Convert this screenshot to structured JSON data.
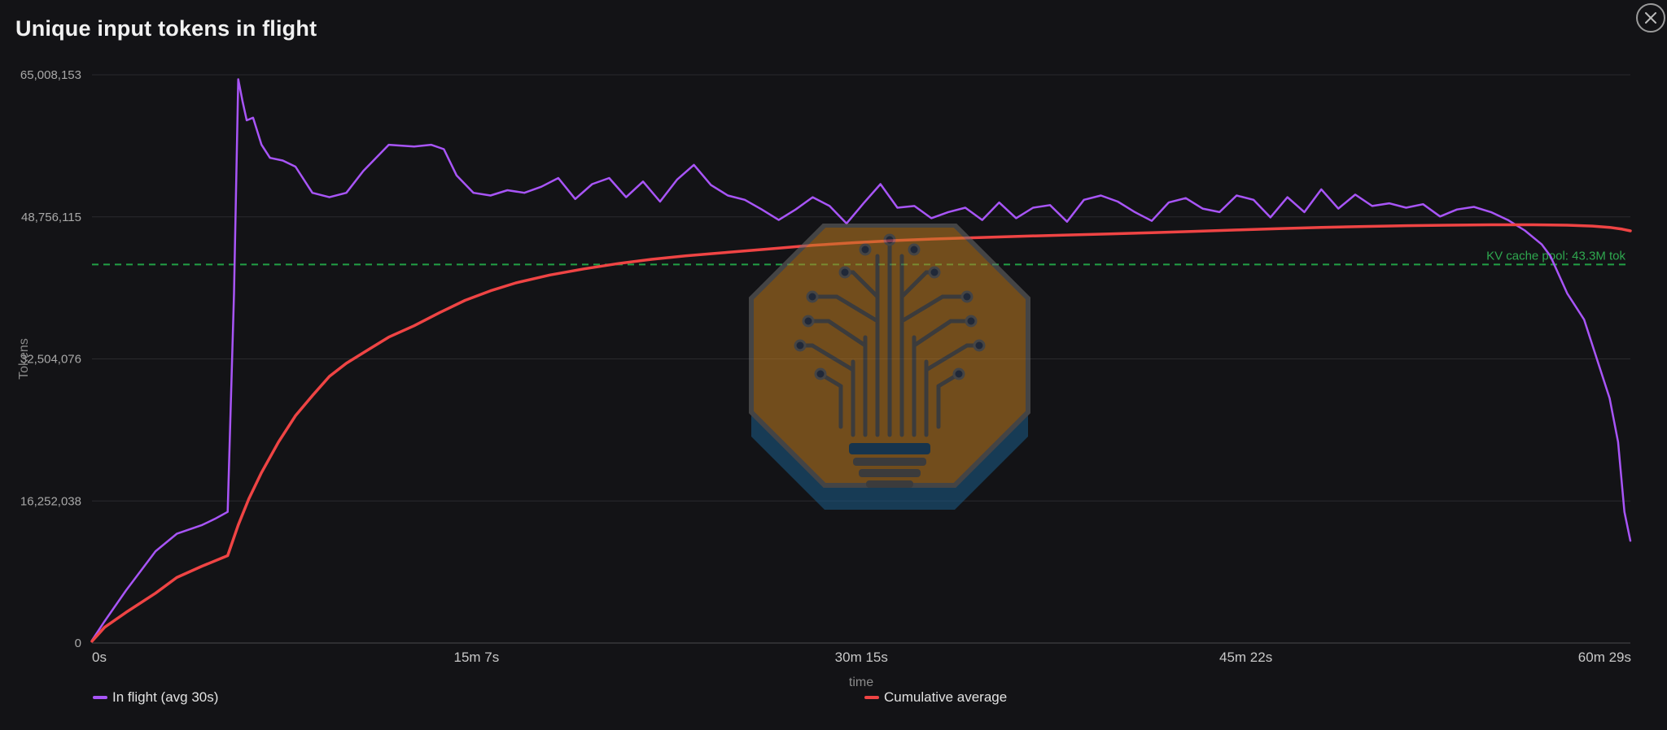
{
  "title": "Unique input tokens in flight",
  "close_icon": "close-icon",
  "colors": {
    "in_flight": "#a855f7",
    "cumulative": "#ef4444",
    "reference": "#22a045",
    "grid": "#2a2a2e",
    "background": "#131316"
  },
  "chart_data": {
    "type": "line",
    "title": "Unique input tokens in flight",
    "xlabel": "time",
    "ylabel": "Tokens",
    "x_unit": "seconds",
    "xlim": [
      0,
      3629
    ],
    "ylim": [
      0,
      65008153
    ],
    "x_tick_values": [
      0,
      907,
      1815,
      2722,
      3629
    ],
    "x_tick_labels": [
      "0s",
      "15m 7s",
      "30m 15s",
      "45m 22s",
      "60m 29s"
    ],
    "y_tick_values": [
      0,
      16252038,
      32504076,
      48756115,
      65008153
    ],
    "y_tick_labels": [
      "0",
      "16,252,038",
      "32,504,076",
      "48,756,115",
      "65,008,153"
    ],
    "grid": true,
    "legend_position": "bottom",
    "reference_line": {
      "y": 43300000,
      "label": "KV cache pool: 43.3M tok",
      "style": "dashed"
    },
    "series": [
      {
        "name": "In flight (avg 30s)",
        "x": [
          0,
          30,
          80,
          150,
          200,
          260,
          290,
          320,
          335,
          345,
          355,
          365,
          380,
          400,
          420,
          450,
          480,
          520,
          560,
          600,
          640,
          700,
          760,
          800,
          830,
          860,
          900,
          940,
          980,
          1020,
          1060,
          1100,
          1140,
          1180,
          1220,
          1260,
          1300,
          1340,
          1380,
          1420,
          1460,
          1500,
          1540,
          1580,
          1620,
          1660,
          1700,
          1740,
          1780,
          1820,
          1860,
          1900,
          1940,
          1980,
          2020,
          2060,
          2100,
          2140,
          2180,
          2220,
          2260,
          2300,
          2340,
          2380,
          2420,
          2460,
          2500,
          2540,
          2580,
          2620,
          2660,
          2700,
          2740,
          2780,
          2820,
          2860,
          2900,
          2940,
          2980,
          3020,
          3060,
          3100,
          3140,
          3180,
          3220,
          3260,
          3300,
          3340,
          3380,
          3420,
          3440,
          3480,
          3520,
          3560,
          3580,
          3600,
          3615,
          3629
        ],
        "values": [
          300000,
          2500000,
          6000000,
          10500000,
          12500000,
          13500000,
          14200000,
          15000000,
          40000000,
          64500000,
          62000000,
          59800000,
          60100000,
          57000000,
          55500000,
          55200000,
          54500000,
          51500000,
          51000000,
          51500000,
          54000000,
          57000000,
          56800000,
          57000000,
          56500000,
          53500000,
          51500000,
          51200000,
          51800000,
          51500000,
          52200000,
          53200000,
          50800000,
          52500000,
          53200000,
          51000000,
          52800000,
          50500000,
          53000000,
          54700000,
          52400000,
          51200000,
          50700000,
          49600000,
          48400000,
          49600000,
          51000000,
          50000000,
          48000000,
          50300000,
          52500000,
          49800000,
          50000000,
          48600000,
          49300000,
          49800000,
          48400000,
          50400000,
          48600000,
          49800000,
          50100000,
          48200000,
          50700000,
          51200000,
          50500000,
          49300000,
          48300000,
          50400000,
          50900000,
          49700000,
          49300000,
          51200000,
          50700000,
          48700000,
          51000000,
          49300000,
          51900000,
          49700000,
          51300000,
          50000000,
          50300000,
          49800000,
          50200000,
          48800000,
          49600000,
          49900000,
          49300000,
          48400000,
          47200000,
          45600000,
          44300000,
          40000000,
          37000000,
          31000000,
          28000000,
          23000000,
          15000000,
          11700000
        ]
      },
      {
        "name": "Cumulative average",
        "x": [
          0,
          30,
          80,
          150,
          200,
          260,
          320,
          345,
          370,
          400,
          440,
          480,
          520,
          560,
          600,
          650,
          700,
          760,
          820,
          880,
          940,
          1000,
          1080,
          1160,
          1240,
          1320,
          1400,
          1500,
          1600,
          1700,
          1800,
          1900,
          2000,
          2100,
          2200,
          2300,
          2400,
          2500,
          2600,
          2700,
          2800,
          2900,
          3000,
          3100,
          3200,
          3300,
          3400,
          3480,
          3540,
          3580,
          3610,
          3629
        ],
        "values": [
          200000,
          1800000,
          3500000,
          5700000,
          7500000,
          8800000,
          10000000,
          13500000,
          16500000,
          19500000,
          23000000,
          26000000,
          28300000,
          30500000,
          32000000,
          33500000,
          35000000,
          36300000,
          37800000,
          39200000,
          40300000,
          41200000,
          42100000,
          42800000,
          43400000,
          43900000,
          44300000,
          44700000,
          45100000,
          45500000,
          45800000,
          46050000,
          46250000,
          46400000,
          46550000,
          46680000,
          46800000,
          46950000,
          47100000,
          47250000,
          47400000,
          47550000,
          47650000,
          47750000,
          47800000,
          47850000,
          47850000,
          47800000,
          47700000,
          47550000,
          47350000,
          47150000
        ]
      }
    ]
  },
  "legend": [
    {
      "label": "In flight (avg 30s)",
      "color": "#a855f7"
    },
    {
      "label": "Cumulative average",
      "color": "#ef4444"
    }
  ]
}
